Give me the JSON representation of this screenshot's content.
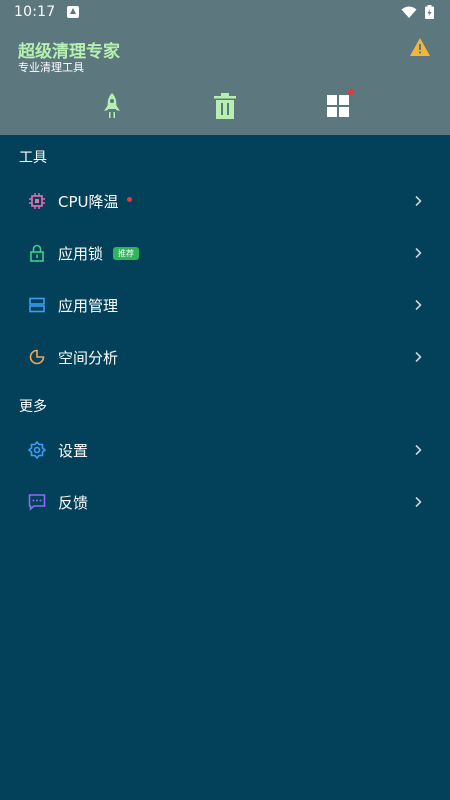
{
  "status_bar": {
    "time": "10:17"
  },
  "header": {
    "title": "超级清理专家",
    "subtitle": "专业清理工具",
    "warning_icon": "warning-icon"
  },
  "quick_actions": [
    {
      "icon": "rocket-icon"
    },
    {
      "icon": "trash-icon"
    },
    {
      "icon": "apps-grid-icon",
      "badge": true
    }
  ],
  "sections": {
    "tools": {
      "title": "工具",
      "items": [
        {
          "label": "CPU降温",
          "icon": "cpu-icon",
          "dot": true
        },
        {
          "label": "应用锁",
          "icon": "lock-icon",
          "tag": "推荐"
        },
        {
          "label": "应用管理",
          "icon": "app-manage-icon"
        },
        {
          "label": "空间分析",
          "icon": "pie-chart-icon"
        }
      ]
    },
    "more": {
      "title": "更多",
      "items": [
        {
          "label": "设置",
          "icon": "gear-icon"
        },
        {
          "label": "反馈",
          "icon": "feedback-icon"
        }
      ]
    }
  },
  "colors": {
    "header_bg": "#5c777e",
    "content_bg": "#03405a",
    "title_green": "#b6f0b0",
    "badge_red": "#e53935",
    "tag_green": "#2fb55a"
  }
}
